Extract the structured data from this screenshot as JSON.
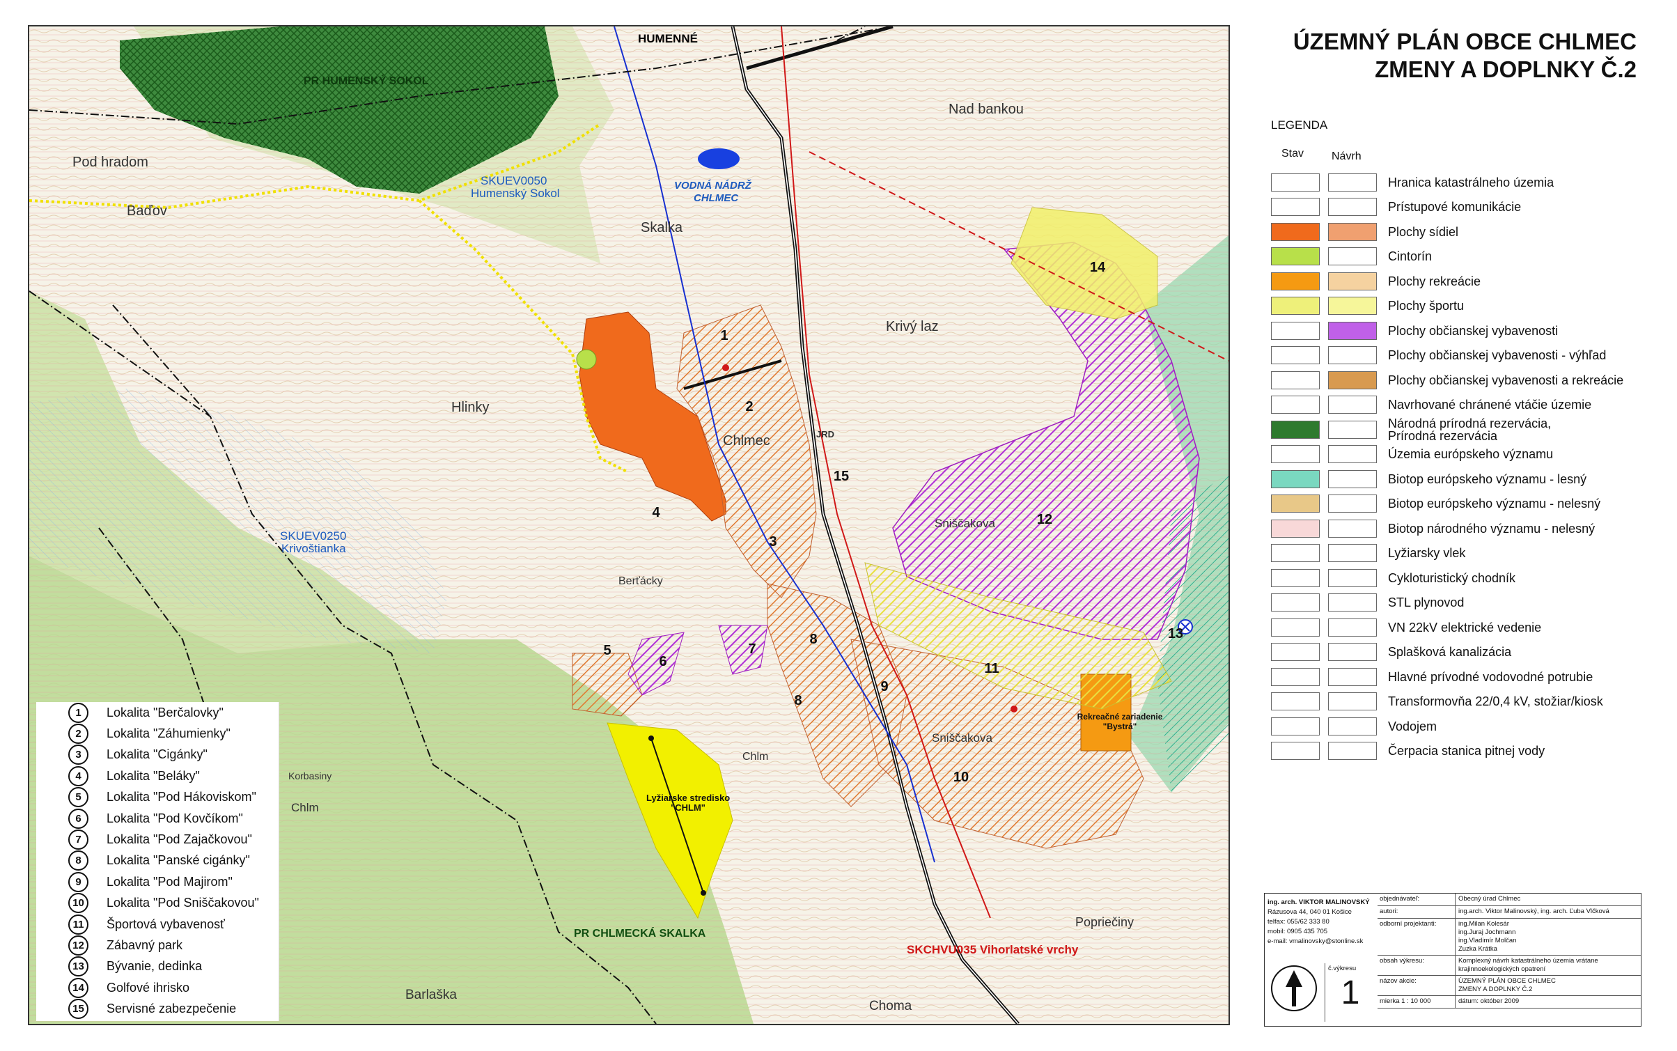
{
  "title": {
    "line1": "ÚZEMNÝ PLÁN OBCE CHLMEC",
    "line2": "ZMENY A DOPLNKY Č.2"
  },
  "legend": {
    "heading": "LEGENDA",
    "col_stav": "Stav",
    "col_navrh": "Návrh",
    "items": [
      {
        "label": "Hranica katastrálneho územia",
        "stav_color": "#ffffff",
        "navrh_color": "#ffffff"
      },
      {
        "label": "Prístupové komunikácie",
        "stav_color": "#ffffff",
        "navrh_color": "#ffffff"
      },
      {
        "label": "Plochy sídiel",
        "stav_color": "#f06a1c",
        "navrh_color": "#f0a070"
      },
      {
        "label": "Cintorín",
        "stav_color": "#b8e04a",
        "navrh_color": "#ffffff"
      },
      {
        "label": "Plochy rekreácie",
        "stav_color": "#f59a12",
        "navrh_color": "#f5d2a0"
      },
      {
        "label": "Plochy športu",
        "stav_color": "#eef07a",
        "navrh_color": "#f6f69a"
      },
      {
        "label": "Plochy občianskej vybavenosti",
        "stav_color": "#ffffff",
        "navrh_color": "#c060e8"
      },
      {
        "label": "Plochy občianskej vybavenosti - výhľad",
        "stav_color": "#ffffff",
        "navrh_color": "#ffffff"
      },
      {
        "label": "Plochy občianskej vybavenosti a rekreácie",
        "stav_color": "#ffffff",
        "navrh_color": "#d89a50"
      },
      {
        "label": "Navrhované chránené vtáčie územie",
        "stav_color": "#ffffff",
        "navrh_color": "#ffffff"
      },
      {
        "label": "Národná prírodná rezervácia,\nPrírodná rezervácia",
        "stav_color": "#2e7a2e",
        "navrh_color": "#ffffff"
      },
      {
        "label": "Územia európskeho významu",
        "stav_color": "#ffffff",
        "navrh_color": "#ffffff"
      },
      {
        "label": "Biotop európskeho významu - lesný",
        "stav_color": "#7ad8c0",
        "navrh_color": "#ffffff"
      },
      {
        "label": "Biotop európskeho významu - nelesný",
        "stav_color": "#e8c888",
        "navrh_color": "#ffffff"
      },
      {
        "label": "Biotop národného významu - nelesný",
        "stav_color": "#f8d8d8",
        "navrh_color": "#ffffff"
      },
      {
        "label": "Lyžiarsky vlek",
        "stav_color": "#ffffff",
        "navrh_color": "#ffffff"
      },
      {
        "label": "Cykloturistický chodník",
        "stav_color": "#ffffff",
        "navrh_color": "#ffffff"
      },
      {
        "label": "STL plynovod",
        "stav_color": "#ffffff",
        "navrh_color": "#ffffff"
      },
      {
        "label": "VN 22kV elektrické vedenie",
        "stav_color": "#ffffff",
        "navrh_color": "#ffffff"
      },
      {
        "label": "Splašková kanalizácia",
        "stav_color": "#ffffff",
        "navrh_color": "#ffffff"
      },
      {
        "label": "Hlavné prívodné vodovodné potrubie",
        "stav_color": "#ffffff",
        "navrh_color": "#ffffff"
      },
      {
        "label": "Transformovňa 22/0,4 kV, stožiar/kiosk",
        "stav_color": "#ffffff",
        "navrh_color": "#ffffff"
      },
      {
        "label": "Vodojem",
        "stav_color": "#ffffff",
        "navrh_color": "#ffffff"
      },
      {
        "label": "Čerpacia stanica pitnej vody",
        "stav_color": "#ffffff",
        "navrh_color": "#ffffff"
      }
    ]
  },
  "lokality": [
    {
      "num": "1",
      "label": "Lokalita \"Berčalovky\""
    },
    {
      "num": "2",
      "label": "Lokalita \"Záhumienky\""
    },
    {
      "num": "3",
      "label": "Lokalita \"Cigánky\""
    },
    {
      "num": "4",
      "label": "Lokalita \"Beláky\""
    },
    {
      "num": "5",
      "label": "Lokalita \"Pod Hákoviskom\""
    },
    {
      "num": "6",
      "label": "Lokalita \"Pod Kovčíkom\""
    },
    {
      "num": "7",
      "label": "Lokalita \"Pod Zajačkovou\""
    },
    {
      "num": "8",
      "label": "Lokalita \"Panské cigánky\""
    },
    {
      "num": "9",
      "label": "Lokalita \"Pod Majirom\""
    },
    {
      "num": "10",
      "label": "Lokalita \"Pod Sniščakovou\""
    },
    {
      "num": "11",
      "label": "Športová vybavenosť"
    },
    {
      "num": "12",
      "label": "Zábavný park"
    },
    {
      "num": "13",
      "label": "Bývanie, dedinka"
    },
    {
      "num": "14",
      "label": "Golfové ihrisko"
    },
    {
      "num": "15",
      "label": "Servisné zabezpečenie"
    }
  ],
  "map_labels": {
    "humenne": "HUMENNÉ",
    "pr_humensky_sokol": "PR HUMENSKÝ SOKOL",
    "skuev0050": "SKUEV0050",
    "skuev0050_name": "Humenský Sokol",
    "skuev0250": "SKUEV0250",
    "skuev0250_name": "Krivoštianka",
    "vodna_nadrz_1": "VODNÁ NÁDRŽ",
    "vodna_nadrz_2": "CHLMEC",
    "pod_hradom": "Pod hradom",
    "badov": "Baďov",
    "skalka": "Skalka",
    "hlinky": "Hlinky",
    "nad_bankou": "Nad bankou",
    "krivy_laz": "Krivý laz",
    "chlmec": "Chlmec",
    "bertacky": "Berťácky",
    "chlm": "Chlm",
    "chlm2": "Chlm",
    "sniscakova": "Sniščakova",
    "sniscakova2": "Sniščakova",
    "barlaska": "Barlaška",
    "choma": "Choma",
    "poprieciny": "Popriečiny",
    "korbasiny": "Korbasiny",
    "pr_chlmecka_skalka": "PR CHLMECKÁ SKALKA",
    "skchvu035": "SKCHVU035 Vihorlatské vrchy",
    "lyziarske_1": "Lyžiarske stredisko",
    "lyziarske_2": "\"CHLM\"",
    "rekreacne_1": "Rekreačné zariadenie",
    "rekreacne_2": "\"Bystrá\"",
    "jrd": "JRD"
  },
  "zone_numbers": [
    "1",
    "2",
    "3",
    "4",
    "5",
    "6",
    "7",
    "8",
    "8",
    "9",
    "10",
    "11",
    "12",
    "13",
    "14",
    "15"
  ],
  "info_block": {
    "author_name": "ing. arch. VIKTOR MALINOVSKÝ",
    "author_address": "Rázusova 44, 040 01 Košice",
    "author_phone": "telfax: 055/62 333 80",
    "author_mobile": "mobil: 0905 435 705",
    "author_email": "e-mail: vmalinovsky@stonline.sk",
    "rows": [
      {
        "key": "objednávateľ:",
        "value": "Obecný úrad Chlmec"
      },
      {
        "key": "autori:",
        "value": "ing.arch. Viktor Malinovský, ing. arch. Ľuba Vlčková"
      },
      {
        "key": "odborní projektanti:",
        "value": "ing.Milan Kolesár\ning.Juraj Jochmann\ning.Vladimír Molčan\nZuzka Krátka"
      },
      {
        "key": "obsah výkresu:",
        "value": "Komplexný návrh katastrálneho územia vrátane krajinnoekologických opatrení"
      },
      {
        "key": "názov akcie:",
        "value": "ÚZEMNÝ PLÁN OBCE CHLMEC\nZMENY A DOPLNKY Č.2"
      },
      {
        "key": "mierka 1 : 10 000",
        "value": "dátum: október 2009"
      }
    ],
    "vykres_label": "č.výkresu",
    "vykres_value": "1"
  },
  "colors": {
    "sidla": "#f06a1c",
    "rekreacia": "#f5b26a",
    "sport": "#f2f06a",
    "vybavenost": "#b040d8",
    "les": "#9ac870",
    "rezervacia": "#2e7a2e",
    "voda": "#1848e0"
  }
}
